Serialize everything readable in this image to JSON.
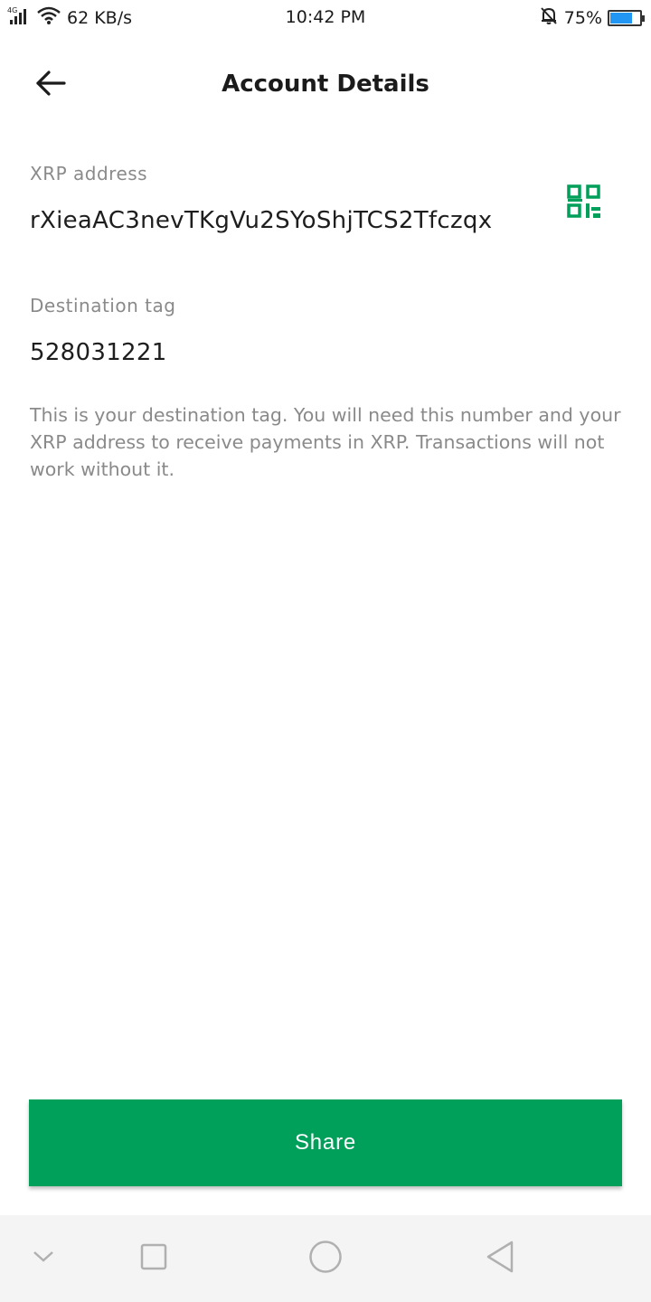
{
  "status_bar": {
    "network_type": "4G",
    "speed": "62 KB/s",
    "time": "10:42 PM",
    "battery": "75%",
    "battery_level": 0.75
  },
  "header": {
    "title": "Account Details"
  },
  "address": {
    "label": "XRP address",
    "value": "rXieaAC3nevTKgVu2SYoShjTCS2Tfczqx"
  },
  "tag": {
    "label": "Destination tag",
    "value": "528031221"
  },
  "help_text": "This is your destination tag. You will need this number and your XRP address to receive payments in XRP. Transactions will not work without it.",
  "share_button": {
    "label": "Share"
  },
  "colors": {
    "accent": "#009f5a",
    "muted_text": "#8a8a8a"
  }
}
